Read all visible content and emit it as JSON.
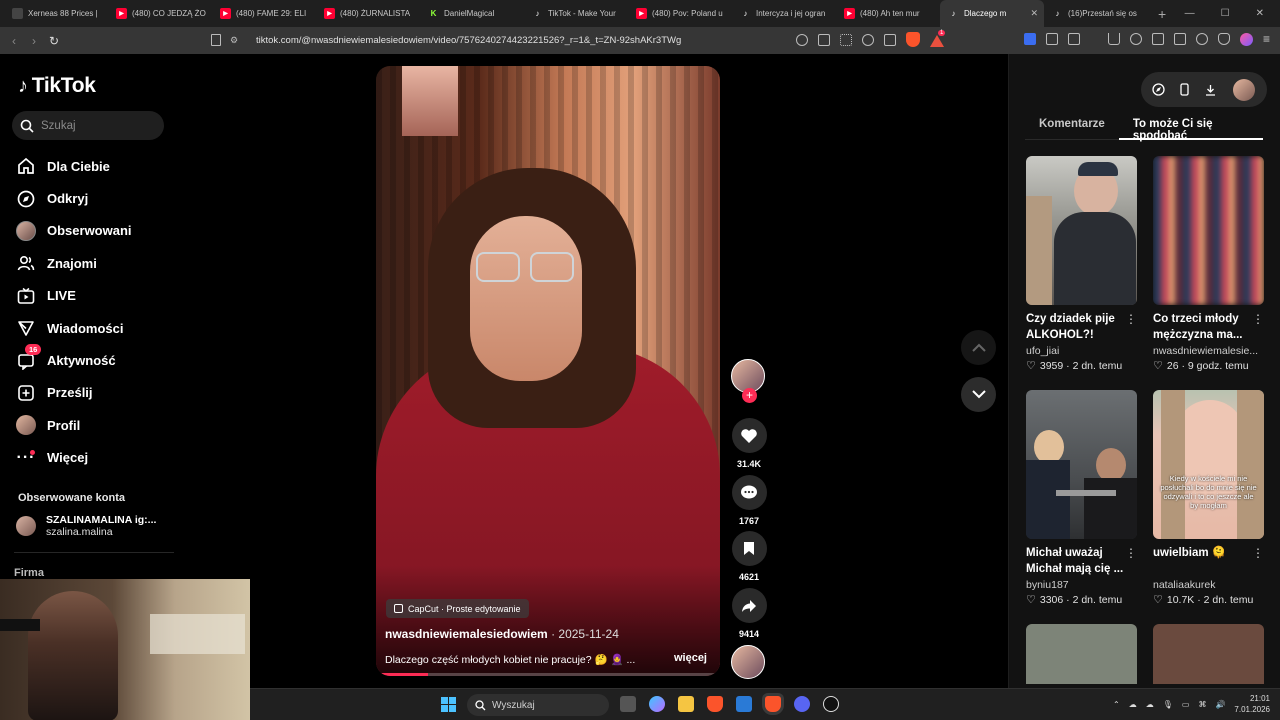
{
  "browser": {
    "tabs": [
      {
        "title": "Xerneas 88 Prices |",
        "favicon": "generic"
      },
      {
        "title": "(480) CO JEDZĄ ŻO",
        "favicon": "youtube"
      },
      {
        "title": "(480) FAME 29: ELI",
        "favicon": "youtube"
      },
      {
        "title": "(480) ŻURNALISTA",
        "favicon": "youtube"
      },
      {
        "title": "DanielMagical",
        "favicon": "kick"
      },
      {
        "title": "TikTok - Make Your",
        "favicon": "tiktok"
      },
      {
        "title": "(480) Pov: Poland u",
        "favicon": "youtube"
      },
      {
        "title": "Intercyza i jej ogran",
        "favicon": "tiktok"
      },
      {
        "title": "(480) Ah ten mur",
        "favicon": "youtube"
      },
      {
        "title": "Dlaczego m",
        "favicon": "tiktok",
        "active": true
      },
      {
        "title": "(16)Przestań się os",
        "favicon": "tiktok"
      }
    ],
    "new_tab": "+",
    "url": "tiktok.com/@nwasdniewiemalesiedowiem/video/7576240274423221526?_r=1&_t=ZN-92shAKr3TWg",
    "extension_badge": "1"
  },
  "sidebar": {
    "logo": "TikTok",
    "search_placeholder": "Szukaj",
    "nav": [
      {
        "label": "Dla Ciebie",
        "icon": "home-icon"
      },
      {
        "label": "Odkryj",
        "icon": "compass-icon"
      },
      {
        "label": "Obserwowani",
        "icon": "avatar-icon"
      },
      {
        "label": "Znajomi",
        "icon": "friends-icon"
      },
      {
        "label": "LIVE",
        "icon": "live-icon"
      },
      {
        "label": "Wiadomości",
        "icon": "send-icon"
      },
      {
        "label": "Aktywność",
        "icon": "inbox-icon",
        "badge": "16"
      },
      {
        "label": "Prześlij",
        "icon": "upload-icon"
      },
      {
        "label": "Profil",
        "icon": "profile-avatar-icon"
      },
      {
        "label": "Więcej",
        "icon": "more-icon"
      }
    ],
    "followed_title": "Obserwowane konta",
    "followed": [
      {
        "name": "SZALINAMALINA ig:...",
        "handle": "szalina.malina"
      }
    ],
    "company": "Firma"
  },
  "video": {
    "capcut_label": "CapCut · Proste edytowanie",
    "author": "nwasdniewiemalesiedowiem",
    "date": " · 2025-11-24",
    "description": "Dlaczego część młodych kobiet nie pracuje? 🤔 🧕 ...",
    "more_label": "więcej",
    "progress": 0.15
  },
  "actions": {
    "likes": "31.4K",
    "comments": "1767",
    "saves": "4621",
    "shares": "9414"
  },
  "right_panel": {
    "tabs": [
      "Komentarze",
      "To może Ci się spodobać"
    ],
    "active_tab": 1,
    "cards": [
      {
        "title": "Czy dziadek pije ALKOHOL?! #sor...",
        "author": "ufo_jiai",
        "likes": "3959",
        "time": "2 dn. temu"
      },
      {
        "title": "Co trzeci młody mężczyzna ma...",
        "author": "nwasdniewiemalesie...",
        "likes": "26",
        "time": "9 godz. temu"
      },
      {
        "title": "Michał uważaj Michał mają cię ...",
        "author": "byniu187",
        "likes": "3306",
        "time": "2 dn. temu"
      },
      {
        "title": "uwielbiam 🫠",
        "author": "nataliaakurek",
        "likes": "10.7K",
        "time": "2 dn. temu"
      }
    ],
    "card_caption": "Kiedy w kościele mi nie posłuchali bo do mnie się nie odzywali i to co jeszcze ale by mogłam"
  },
  "taskbar": {
    "search_placeholder": "Wyszukaj",
    "time": "21:01",
    "date": "7.01.2026"
  }
}
